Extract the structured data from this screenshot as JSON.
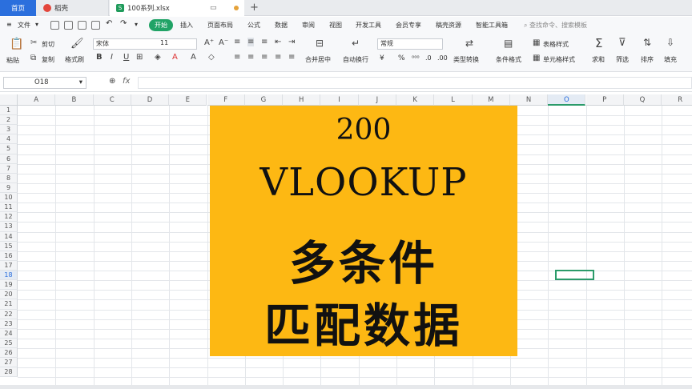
{
  "tabs": {
    "home": "首页",
    "daoke": "稻壳",
    "file": "100系列.xlsx"
  },
  "menu": {
    "file": "文件",
    "start": "开始",
    "items": [
      "插入",
      "页面布局",
      "公式",
      "数据",
      "审阅",
      "视图",
      "开发工具",
      "会员专享",
      "稿壳资源",
      "智能工具箱"
    ],
    "search_hint": "查找命令、搜索模板"
  },
  "ribbon": {
    "paste": "粘贴",
    "cut": "剪切",
    "copy": "复制",
    "format_painter": "格式刷",
    "font": "宋体",
    "size": "11",
    "merge": "合并居中",
    "wrap": "自动换行",
    "number_format": "常规",
    "type_convert": "类型转换",
    "cond_format": "条件格式",
    "table_style": "表格样式",
    "cell_style": "单元格样式",
    "sum": "求和",
    "filter": "筛选",
    "sort": "排序",
    "fill": "填充",
    "currency": "¥",
    "percent": "%"
  },
  "formula_bar": {
    "cell_ref": "O18",
    "fx": "fx"
  },
  "columns": [
    "A",
    "B",
    "C",
    "D",
    "E",
    "F",
    "G",
    "H",
    "I",
    "J",
    "K",
    "L",
    "M",
    "N",
    "O",
    "P",
    "Q",
    "R"
  ],
  "rows": [
    "1",
    "2",
    "3",
    "4",
    "5",
    "6",
    "7",
    "8",
    "9",
    "10",
    "11",
    "12",
    "13",
    "14",
    "15",
    "16",
    "17",
    "18",
    "19",
    "20",
    "21",
    "22",
    "23",
    "24",
    "25",
    "26",
    "27",
    "28"
  ],
  "selected_column": "O",
  "selected_row": "18",
  "banner": {
    "number": "200",
    "function": "VLOOKUP",
    "line1": "多条件",
    "line2": "匹配数据"
  },
  "colors": {
    "banner_bg": "#fdb813",
    "accent_green": "#21a366",
    "home_tab": "#2b6fdd"
  }
}
